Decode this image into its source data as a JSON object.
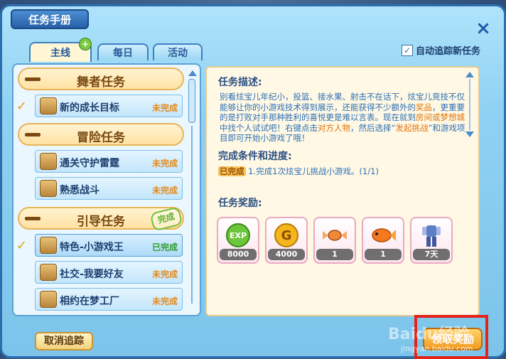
{
  "window": {
    "title": "任务手册",
    "close": "×"
  },
  "tabs": [
    {
      "label": "主线",
      "active": true
    },
    {
      "label": "每日",
      "active": false
    },
    {
      "label": "活动",
      "active": false
    }
  ],
  "auto_track": {
    "label": "自动追踪新任务",
    "checked": "✓"
  },
  "categories": [
    {
      "label": "舞者任务"
    },
    {
      "label": "冒险任务"
    },
    {
      "label": "引导任务",
      "stamp": "完成"
    }
  ],
  "items": [
    {
      "name": "新的成长目标",
      "status": "未完成",
      "icon_text": "舞者",
      "tick": "✓"
    },
    {
      "name": "通关守护雷霆",
      "status": "未完成",
      "icon_text": "冒险"
    },
    {
      "name": "熟悉战斗",
      "status": "未完成",
      "icon_text": "冒险"
    },
    {
      "name": "特色-小游戏王",
      "status": "已完成",
      "icon_text": "引导",
      "tick": "✓"
    },
    {
      "name": "社交-我要好友",
      "status": "未完成",
      "icon_text": "引导"
    },
    {
      "name": "相约在梦工厂",
      "status": "未完成",
      "icon_text": "引导"
    }
  ],
  "detail": {
    "desc_title": "任务描述:",
    "desc": {
      "p1": "别看炫宝儿年纪小，投篮、接水果、射击不在话下，炫宝儿竞技不仅能够让你的小游戏技术得到展示，还能获得不少额外的",
      "hl1": "奖品",
      "p2": "，更重要的是打败对手那种胜利的喜悦更是难以言表。现在就到",
      "hl2": "房间或梦想城",
      "p3": "中找个人试试吧！右键点击",
      "hl3": "对方人物",
      "p4": "，然后选择“",
      "hl4": "发起挑战",
      "p5": "”和游戏项目即可开始小游戏了哦！"
    },
    "progress_title": "完成条件和进度:",
    "progress_tag": "已完成",
    "progress_text": "1.完成1次炫宝儿挑战小游戏。(1/1)",
    "reward_title": "任务奖励:"
  },
  "rewards": [
    {
      "icon": "exp-orb-icon",
      "label": "EXP",
      "qty": "8000"
    },
    {
      "icon": "gold-coin-icon",
      "label": "G",
      "qty": "4000"
    },
    {
      "icon": "candy-icon",
      "qty": "1"
    },
    {
      "icon": "fish-icon",
      "qty": "1"
    },
    {
      "icon": "outfit-icon",
      "qty": "7天"
    }
  ],
  "buttons": {
    "cancel_track": "取消追踪",
    "claim": "领取奖励"
  },
  "watermark": {
    "main": "Baidu经验",
    "sub": "jingyan.baidu.com"
  },
  "colors": {
    "accent_orange": "#e28a1c",
    "done_green": "#2e9c2e",
    "highlight_red": "#e2231a"
  }
}
